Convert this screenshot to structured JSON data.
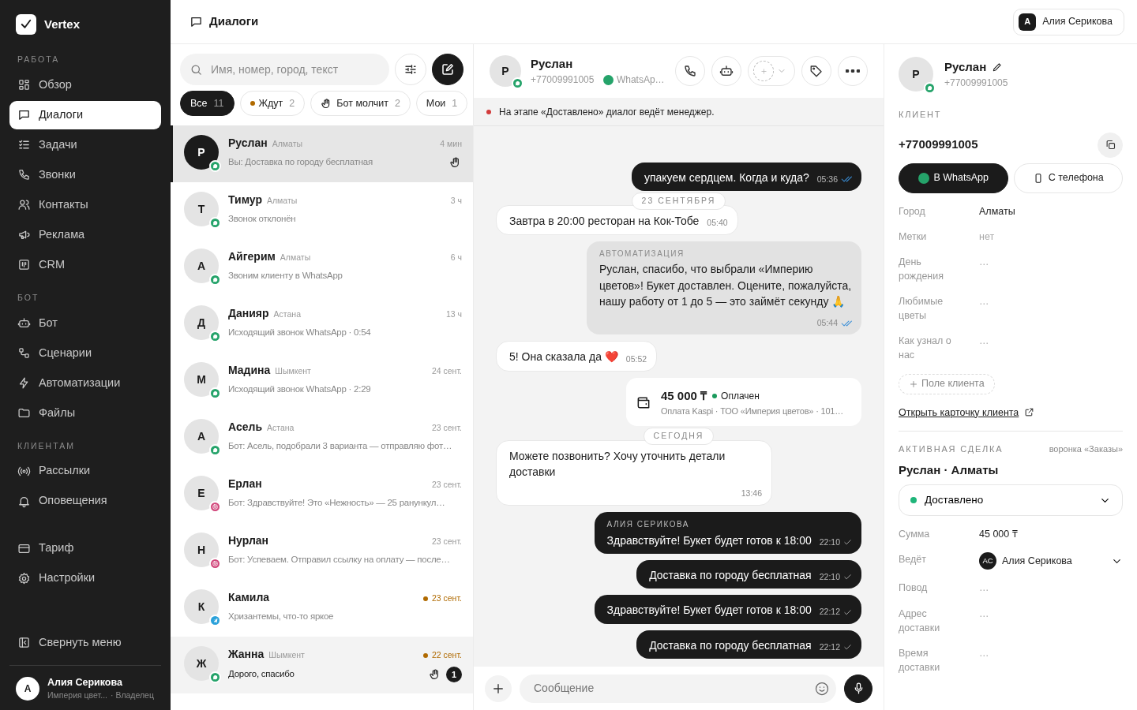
{
  "sidebar": {
    "logo": "Vertex",
    "sections": [
      {
        "title": "РАБОТА",
        "items": [
          {
            "label": "Обзор",
            "selected": false
          },
          {
            "label": "Диалоги",
            "selected": true
          },
          {
            "label": "Задачи",
            "selected": false
          },
          {
            "label": "Звонки",
            "selected": false
          },
          {
            "label": "Контакты",
            "selected": false
          },
          {
            "label": "Реклама",
            "selected": false
          },
          {
            "label": "CRM",
            "selected": false
          }
        ]
      },
      {
        "title": "БОТ",
        "items": [
          {
            "label": "Бот",
            "selected": false
          },
          {
            "label": "Сценарии",
            "selected": false
          },
          {
            "label": "Автоматизации",
            "selected": false
          },
          {
            "label": "Файлы",
            "selected": false
          }
        ]
      },
      {
        "title": "КЛИЕНТАМ",
        "items": [
          {
            "label": "Рассылки",
            "selected": false
          },
          {
            "label": "Оповещения",
            "selected": false
          }
        ]
      },
      {
        "items": [
          {
            "label": "Тариф",
            "selected": false
          },
          {
            "label": "Настройки",
            "selected": false
          }
        ]
      }
    ],
    "collapse": "Свернуть меню",
    "user": {
      "avatar": "А",
      "name": "Алия Серикова",
      "org": "Империя цвет...",
      "role": "· Владелец"
    }
  },
  "header": {
    "title": "Диалоги",
    "user": {
      "avatar": "А",
      "name": "Алия Серикова"
    }
  },
  "list": {
    "search": {
      "placeholder": "Имя, номер, город, текст"
    },
    "filters": [
      {
        "label": "Все",
        "count": "11",
        "kind": "plain",
        "selected": true
      },
      {
        "label": "Ждут",
        "count": "2",
        "kind": "dot",
        "selected": false
      },
      {
        "label": "Бот молчит",
        "count": "2",
        "kind": "hand",
        "selected": false
      },
      {
        "label": "Мои",
        "count": "1",
        "kind": "plain",
        "selected": false
      }
    ],
    "conversations": [
      {
        "avatar": "Р",
        "name": "Руслан",
        "city": "Алматы",
        "preview": "Вы: Доставка по городу бесплатная",
        "time": "4 мин",
        "kind": "whatsapp",
        "selected": true,
        "waiting": false,
        "bot_paused": true
      },
      {
        "avatar": "Т",
        "name": "Тимур",
        "city": "Алматы",
        "preview": "Звонок отклонён",
        "time": "3 ч",
        "kind": "whatsapp",
        "selected": false,
        "waiting": false,
        "bot_paused": false
      },
      {
        "avatar": "А",
        "name": "Айгерим",
        "city": "Алматы",
        "preview": "Звоним клиенту в WhatsApp",
        "time": "6 ч",
        "kind": "whatsapp",
        "selected": false,
        "waiting": false,
        "bot_paused": false
      },
      {
        "avatar": "Д",
        "name": "Данияр",
        "city": "Астана",
        "preview": "Исходящий звонок WhatsApp · 0:54",
        "time": "13 ч",
        "kind": "whatsapp",
        "selected": false,
        "waiting": false,
        "bot_paused": false
      },
      {
        "avatar": "М",
        "name": "Мадина",
        "city": "Шымкент",
        "preview": "Исходящий звонок WhatsApp · 2:29",
        "time": "24 сент.",
        "kind": "whatsapp",
        "selected": false,
        "waiting": false,
        "bot_paused": false
      },
      {
        "avatar": "А",
        "name": "Асель",
        "city": "Астана",
        "preview": "Бот: Асель, подобрали 3 варианта — отправляю фот…",
        "time": "23 сент.",
        "kind": "whatsapp",
        "selected": false,
        "waiting": false,
        "bot_paused": false
      },
      {
        "avatar": "Е",
        "name": "Ерлан",
        "preview": "Бот: Здравствуйте! Это «Нежность» — 25 ранункул…",
        "time": "23 сент.",
        "kind": "instagram",
        "selected": false,
        "waiting": false,
        "bot_paused": false
      },
      {
        "avatar": "Н",
        "name": "Нурлан",
        "preview": "Бот: Успеваем. Отправил ссылку на оплату — после…",
        "time": "23 сент.",
        "kind": "instagram",
        "selected": false,
        "waiting": false,
        "bot_paused": false
      },
      {
        "avatar": "К",
        "name": "Камила",
        "preview": "Хризантемы, что-то яркое",
        "time": "23 сент.",
        "kind": "telegram",
        "selected": false,
        "waiting": true,
        "bot_paused": false
      },
      {
        "avatar": "Ж",
        "name": "Жанна",
        "city": "Шымкент",
        "preview": "Дорого, спасибо",
        "time": "22 сент.",
        "kind": "whatsapp",
        "selected": false,
        "waiting": true,
        "bot_paused": true,
        "unread": "1"
      }
    ]
  },
  "chat": {
    "avatar": "Р",
    "name": "Руслан",
    "phone": "+77009991005",
    "channel": {
      "kind": "whatsapp",
      "label": "WhatsAp…"
    },
    "banner": "На этапе «Доставлено» диалог ведёт менеджер.",
    "messages": [
      {
        "kind": "outgoing",
        "text": "упакуем сердцем. Когда и куда?",
        "time": "05:36",
        "read": true
      },
      {
        "kind": "date",
        "text": "23 СЕНТЯБРЯ"
      },
      {
        "kind": "incoming",
        "text": "Завтра в 20:00 ресторан на Кок-Тобе",
        "time": "05:40"
      },
      {
        "kind": "automation",
        "author": "АВТОМАТИЗАЦИЯ",
        "text": "Руслан, спасибо, что выбрали «Империю цветов»! Букет доставлен. Оцените, пожалуйста, нашу работу от 1 до 5 — это займёт секунду 🙏",
        "time": "05:44",
        "read": true
      },
      {
        "kind": "incoming",
        "text": "5! Она сказала да ❤️",
        "time": "05:52"
      },
      {
        "kind": "payment",
        "amount": "45 000 ₸",
        "paid": "Оплачен",
        "text": "Оплата Kaspi · ТОО «Империя цветов» · 101…"
      },
      {
        "kind": "date",
        "text": "СЕГОДНЯ"
      },
      {
        "kind": "incoming",
        "text": "Можете позвонить? Хочу уточнить детали доставки",
        "time": "13:46"
      },
      {
        "kind": "outgoing",
        "author": "АЛИЯ СЕРИКОВА",
        "text": "Здравствуйте! Букет будет готов к 18:00",
        "time": "22:10",
        "read": false
      },
      {
        "kind": "outgoing",
        "text": "Доставка по городу бесплатная",
        "time": "22:10",
        "read": false
      },
      {
        "kind": "outgoing",
        "text": "Здравствуйте! Букет будет готов к 18:00",
        "time": "22:12",
        "read": false
      },
      {
        "kind": "outgoing",
        "text": "Доставка по городу бесплатная",
        "time": "22:12",
        "read": false
      }
    ],
    "composer": {
      "placeholder": "Сообщение"
    }
  },
  "client": {
    "avatar": "Р",
    "name": "Руслан",
    "phone": "+77009991005",
    "channel": {
      "kind": "whatsapp"
    },
    "section": "КЛИЕНТ",
    "phone_big": "+77009991005",
    "call_buttons": [
      {
        "label": "В WhatsApp",
        "selected": true
      },
      {
        "label": "С телефона",
        "selected": false
      }
    ],
    "fields": [
      {
        "label": "Город",
        "value": "Алматы",
        "muted": false
      },
      {
        "label": "Метки",
        "value": "нет",
        "muted": true
      },
      {
        "label": "День рождения",
        "value": "…",
        "muted": true
      },
      {
        "label": "Любимые цветы",
        "value": "…",
        "muted": true
      },
      {
        "label": "Как узнал о нас",
        "value": "…",
        "muted": true
      }
    ],
    "add_field": "Поле клиента",
    "open_card": "Открыть карточку клиента"
  },
  "deal": {
    "section": "АКТИВНАЯ СДЕЛКА",
    "funnel": "воронка «Заказы»",
    "title": "Руслан · Алматы",
    "stage": {
      "label": "Доставлено",
      "color": "#1fb57a"
    },
    "fields": [
      {
        "label": "Сумма",
        "value": "45 000 ₸",
        "kind": "text",
        "muted": false
      },
      {
        "label": "Ведёт",
        "value": "Алия Серикова",
        "avatar": "АС",
        "kind": "person",
        "muted": false
      },
      {
        "label": "Повод",
        "value": "…",
        "kind": "text",
        "muted": true
      },
      {
        "label": "Адрес доставки",
        "value": "…",
        "kind": "text",
        "muted": true
      },
      {
        "label": "Время доставки",
        "value": "…",
        "kind": "text",
        "muted": true
      }
    ]
  }
}
